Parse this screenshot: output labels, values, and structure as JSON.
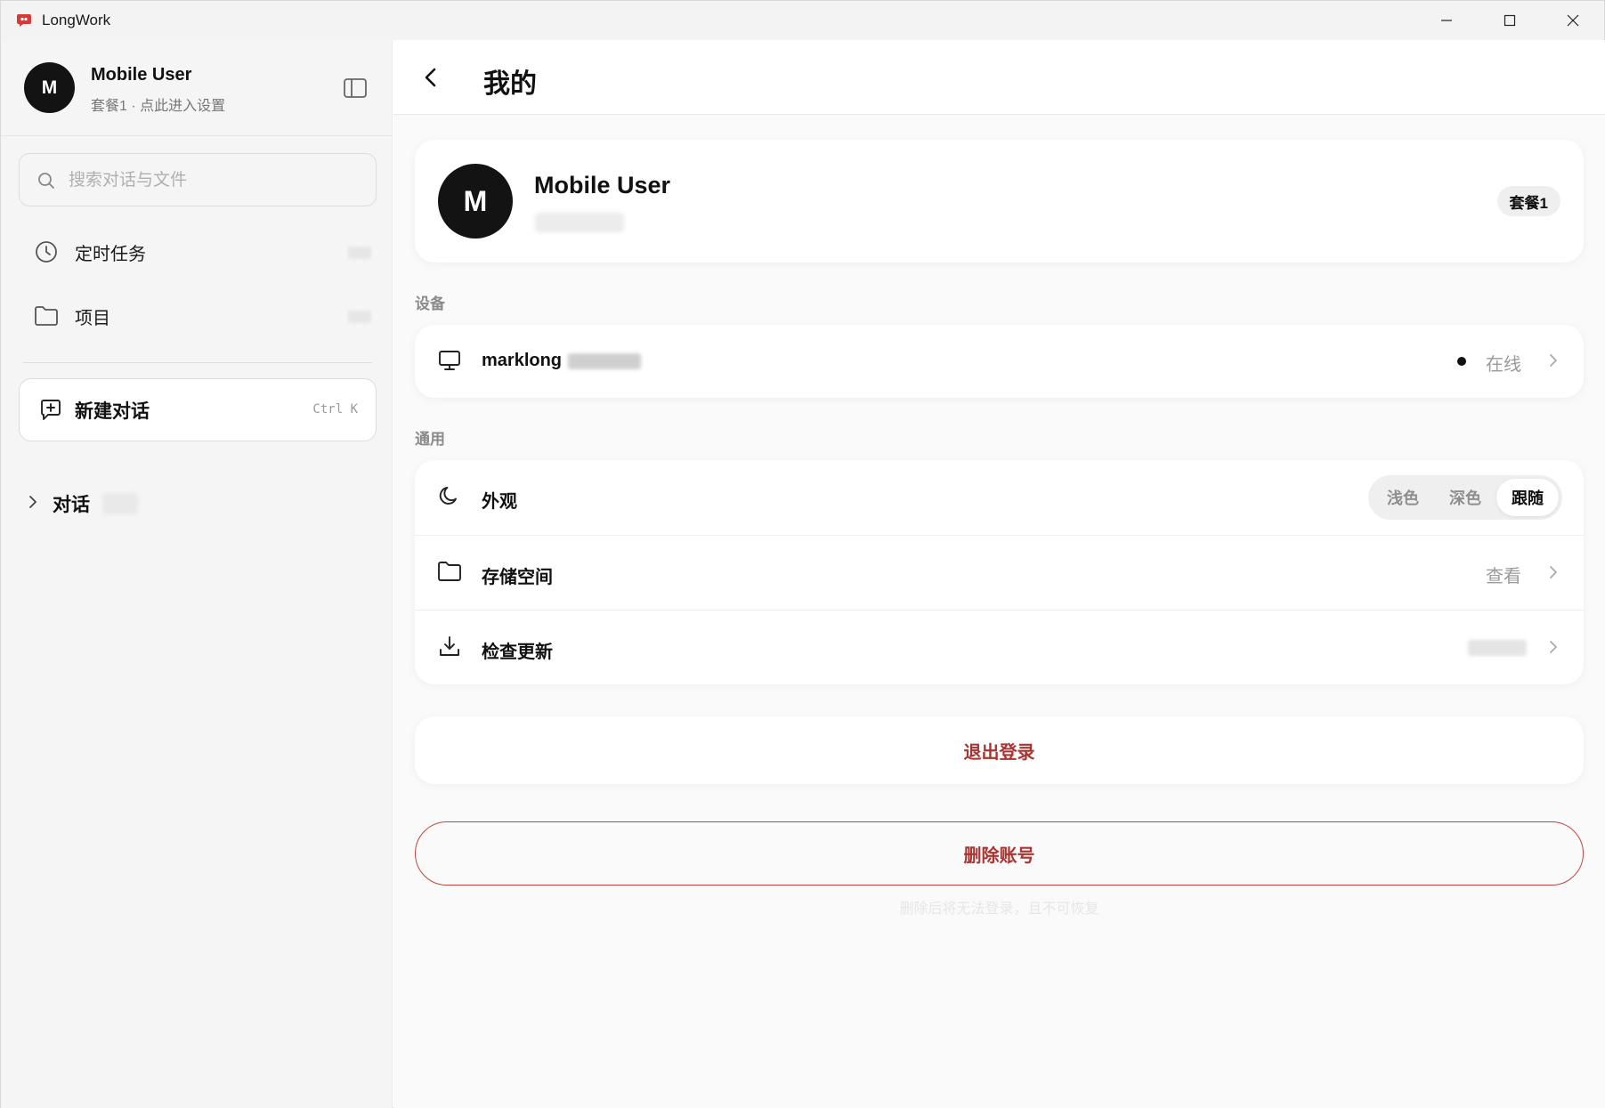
{
  "window": {
    "title": "LongWork",
    "controls": [
      "minimize-icon",
      "maximize-icon",
      "close-icon"
    ]
  },
  "sidebar": {
    "user": {
      "avatar_initial": "M",
      "name": "Mobile User",
      "subtitle": "套餐1 · 点此进入设置"
    },
    "search": {
      "placeholder": "搜索对话与文件",
      "value": ""
    },
    "nav": [
      {
        "label": "定时任务",
        "icon": "clock-icon"
      },
      {
        "label": "项目",
        "icon": "folder-icon"
      }
    ],
    "new_chat": {
      "label": "新建对话",
      "shortcut": "Ctrl K",
      "icon": "message-plus-icon"
    },
    "conversations": {
      "label": "对话",
      "icon": "chevron-right-icon"
    }
  },
  "main": {
    "header": {
      "title": "我的"
    },
    "profile": {
      "avatar_initial": "M",
      "name": "Mobile User",
      "plan_badge": "套餐1"
    },
    "devices": {
      "section_label": "设备",
      "items": [
        {
          "name": "marklong",
          "status": "在线",
          "icon": "monitor-icon"
        }
      ]
    },
    "general": {
      "section_label": "通用",
      "appearance": {
        "label": "外观",
        "icon": "moon-icon",
        "options": [
          "浅色",
          "深色",
          "跟随"
        ],
        "selected": "跟随"
      },
      "storage": {
        "label": "存储空间",
        "action": "查看",
        "icon": "folder-icon"
      },
      "update": {
        "label": "检查更新",
        "icon": "download-icon"
      }
    },
    "logout": {
      "label": "退出登录"
    },
    "delete_account": {
      "label": "删除账号",
      "note": "删除后将无法登录，且不可恢复"
    }
  },
  "colors": {
    "danger": "#a93430",
    "avatar_bg": "#131313",
    "sidebar_bg": "#f5f5f5",
    "main_bg": "#fafafa"
  }
}
